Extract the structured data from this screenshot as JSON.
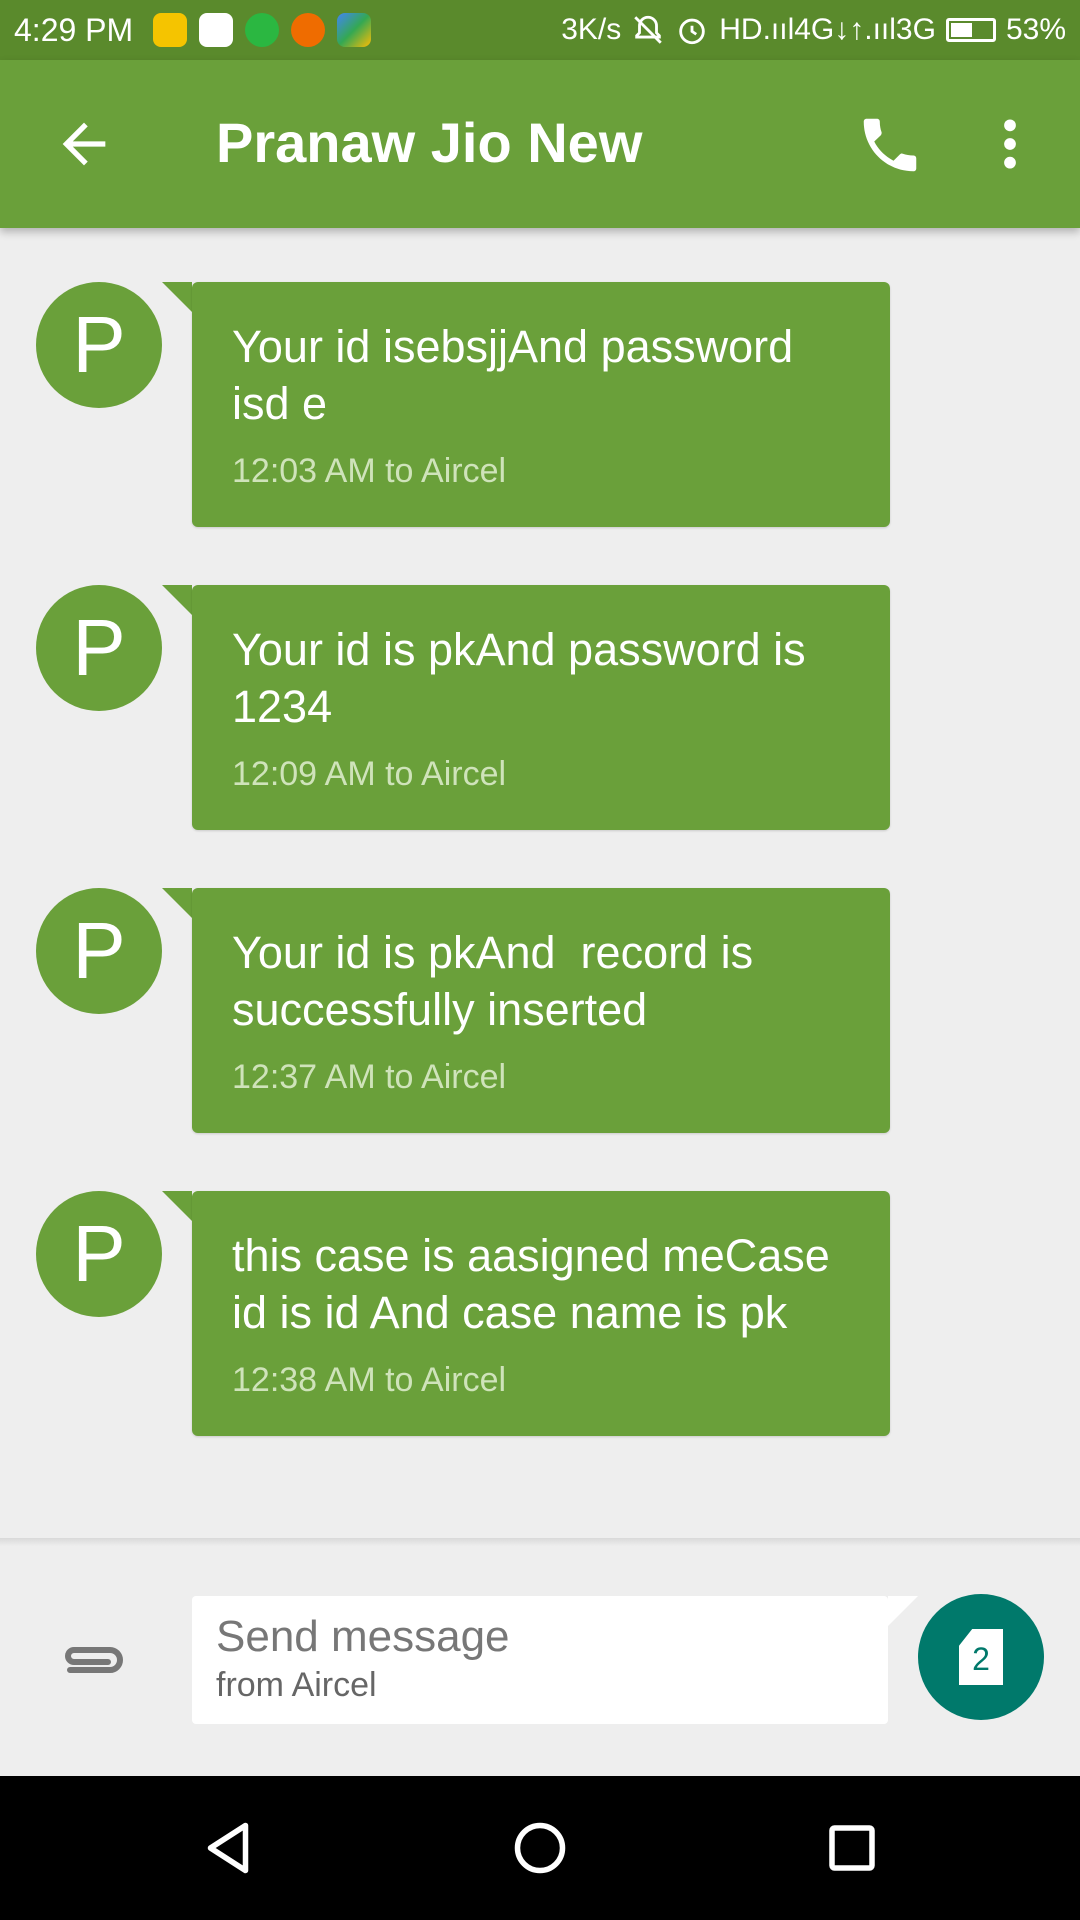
{
  "status_bar": {
    "time": "4:29 PM",
    "network_speed": "3K/s",
    "network_labels": "HD.ııl4G↓↑.ııl3G",
    "battery_percent": "53%",
    "battery_level": 0.53,
    "notification_icons": [
      "flipkart-icon",
      "gmail-icon",
      "whatsapp-icon",
      "app-icon",
      "maps-icon"
    ]
  },
  "app_bar": {
    "title": "Pranaw Jio New",
    "icons": [
      "back-arrow-icon",
      "phone-icon",
      "more-vert-icon"
    ]
  },
  "messages": [
    {
      "avatar": "P",
      "text": "Your id isebsjjAnd password isd e",
      "meta": "12:03 AM to Aircel"
    },
    {
      "avatar": "P",
      "text": "Your id is pkAnd password is 1234",
      "meta": "12:09 AM to Aircel"
    },
    {
      "avatar": "P",
      "text": "Your id is pkAnd  record is successfully inserted",
      "meta": "12:37 AM to Aircel"
    },
    {
      "avatar": "P",
      "text": "this case is aasigned meCase id is id And case name is pk",
      "meta": "12:38 AM to Aircel"
    }
  ],
  "compose": {
    "placeholder": "Send message",
    "sub_label": "from Aircel",
    "sim_number": "2",
    "icons": [
      "attach-icon",
      "sim-card-icon"
    ]
  },
  "nav_bar": {
    "icons": [
      "back-triangle-icon",
      "home-circle-icon",
      "recents-square-icon"
    ]
  },
  "colors": {
    "status_bar": "#5a8a2c",
    "primary": "#6aa03a",
    "send_button": "#00796b",
    "background": "#eeeeee"
  }
}
